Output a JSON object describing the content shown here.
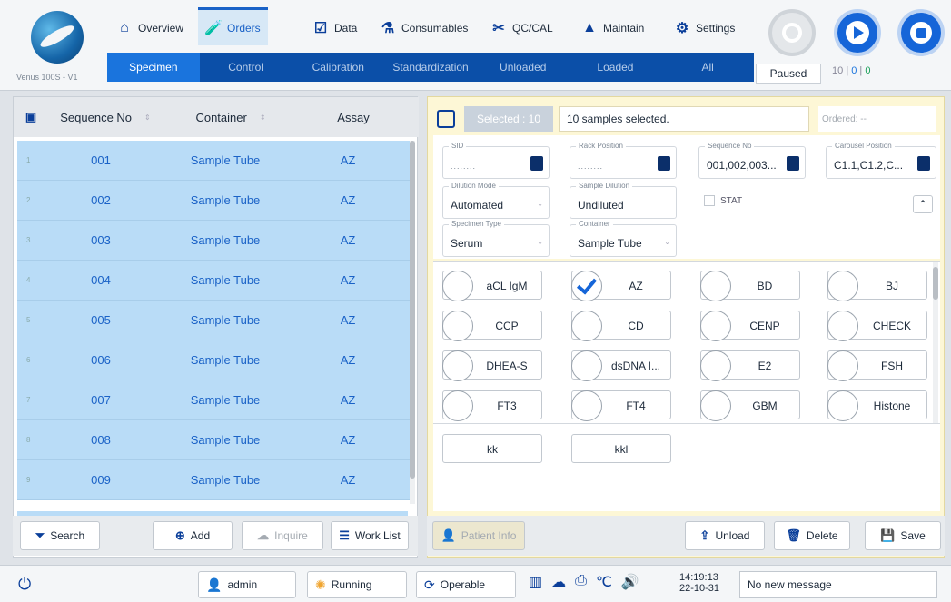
{
  "header": {
    "version": "Venus 100S - V1",
    "nav": [
      {
        "label": "Overview",
        "icon": "home-icon"
      },
      {
        "label": "Orders",
        "icon": "tube-icon"
      },
      {
        "label": "Data",
        "icon": "checklist-icon"
      },
      {
        "label": "Consumables",
        "icon": "flask-icon"
      },
      {
        "label": "QC/CAL",
        "icon": "tools-icon"
      },
      {
        "label": "Maintain",
        "icon": "warning-icon"
      },
      {
        "label": "Settings",
        "icon": "gear-icon"
      }
    ],
    "subtabs": [
      "Specimen",
      "Control",
      "Calibration",
      "Standardization",
      "Unloaded",
      "Loaded",
      "All"
    ],
    "status": "Paused",
    "counts": {
      "a": "10",
      "b": "0",
      "c": "0",
      "sep": "|"
    }
  },
  "table": {
    "headers": [
      "Sequence No",
      "Container",
      "Assay"
    ],
    "rows": [
      {
        "idx": "1",
        "seq": "001",
        "container": "Sample Tube",
        "assay": "AZ"
      },
      {
        "idx": "2",
        "seq": "002",
        "container": "Sample Tube",
        "assay": "AZ"
      },
      {
        "idx": "3",
        "seq": "003",
        "container": "Sample Tube",
        "assay": "AZ"
      },
      {
        "idx": "4",
        "seq": "004",
        "container": "Sample Tube",
        "assay": "AZ"
      },
      {
        "idx": "5",
        "seq": "005",
        "container": "Sample Tube",
        "assay": "AZ"
      },
      {
        "idx": "6",
        "seq": "006",
        "container": "Sample Tube",
        "assay": "AZ"
      },
      {
        "idx": "7",
        "seq": "007",
        "container": "Sample Tube",
        "assay": "AZ"
      },
      {
        "idx": "8",
        "seq": "008",
        "container": "Sample Tube",
        "assay": "AZ"
      },
      {
        "idx": "9",
        "seq": "009",
        "container": "Sample Tube",
        "assay": "AZ"
      }
    ]
  },
  "left_actions": {
    "search": "Search",
    "add": "Add",
    "inquire": "Inquire",
    "worklist": "Work List"
  },
  "detail": {
    "selected": "Selected : 10",
    "message": "10 samples selected.",
    "ordered": "Ordered: --",
    "fields": {
      "sid": {
        "label": "SID",
        "value": "........"
      },
      "rack": {
        "label": "Rack Position",
        "value": "........"
      },
      "seq": {
        "label": "Sequence No",
        "value": "001,002,003..."
      },
      "carousel": {
        "label": "Carousel Position",
        "value": "C1.1,C1.2,C..."
      },
      "dilution_mode": {
        "label": "Dilution Mode",
        "value": "Automated"
      },
      "sample_dilution": {
        "label": "Sample Dilution",
        "value": "Undiluted"
      },
      "specimen_type": {
        "label": "Specimen Type",
        "value": "Serum"
      },
      "container": {
        "label": "Container",
        "value": "Sample Tube"
      }
    },
    "stat": "STAT",
    "assays": [
      {
        "name": "aCL IgM",
        "checked": false
      },
      {
        "name": "AZ",
        "checked": true
      },
      {
        "name": "BD",
        "checked": false
      },
      {
        "name": "BJ",
        "checked": false
      },
      {
        "name": "CCP",
        "checked": false
      },
      {
        "name": "CD",
        "checked": false
      },
      {
        "name": "CENP",
        "checked": false
      },
      {
        "name": "CHECK",
        "checked": false
      },
      {
        "name": "DHEA-S",
        "checked": false
      },
      {
        "name": "dsDNA I...",
        "checked": false
      },
      {
        "name": "E2",
        "checked": false
      },
      {
        "name": "FSH",
        "checked": false
      },
      {
        "name": "FT3",
        "checked": false
      },
      {
        "name": "FT4",
        "checked": false
      },
      {
        "name": "GBM",
        "checked": false
      },
      {
        "name": "Histone",
        "checked": false
      }
    ],
    "profiles": [
      "kk",
      "kkl"
    ]
  },
  "right_actions": {
    "patient": "Patient Info",
    "unload": "Unload",
    "delete": "Delete",
    "save": "Save"
  },
  "footer": {
    "user": "admin",
    "state": "Running",
    "mode": "Operable",
    "time": "14:19:13",
    "date": "22-10-31",
    "message": "No new message"
  }
}
